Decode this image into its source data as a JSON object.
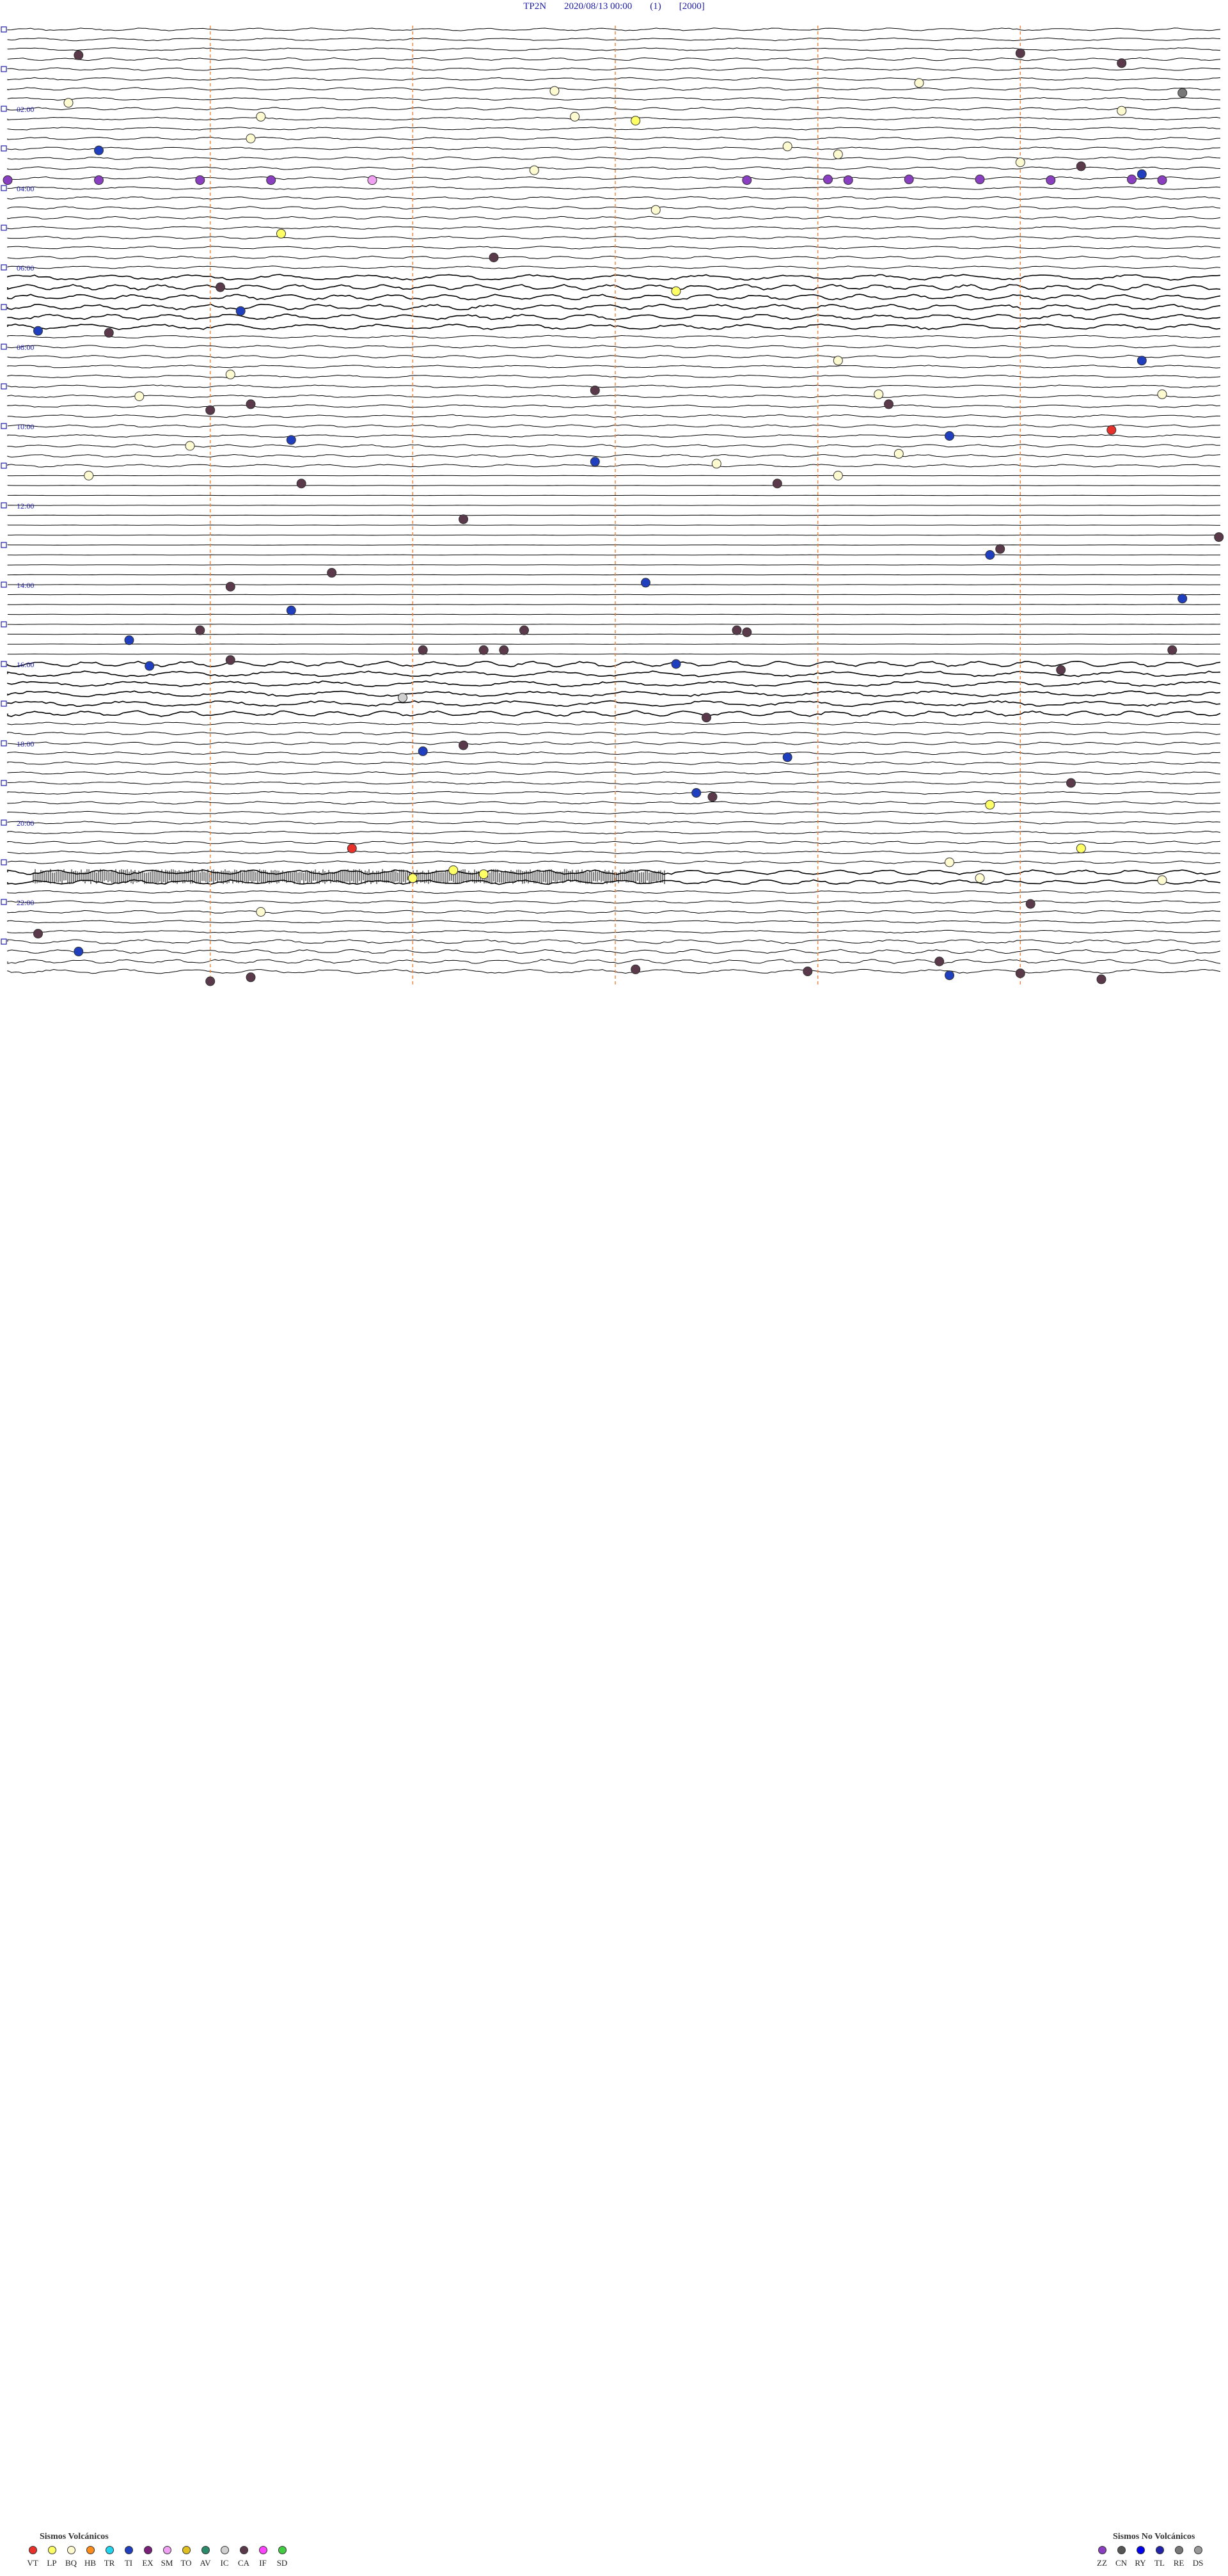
{
  "header": {
    "station": "TP2N",
    "datetime": "2020/08/13 00:00",
    "channel": "(1)",
    "scale": "[2000]"
  },
  "chart_data": {
    "type": "helicorder",
    "traces_per_hour": 4,
    "hours": 24,
    "time_labels": [
      "02:00",
      "04:00",
      "06:00",
      "08:00",
      "10:00",
      "12:00",
      "14:00",
      "16:00",
      "18:00",
      "20:00",
      "22:00"
    ],
    "minute_markers": [
      10,
      20,
      30,
      40,
      50
    ],
    "event_colors": {
      "VT": "#e8312b",
      "LP": "#ffff66",
      "BQ": "#fffbd0",
      "HB": "#ff8c1a",
      "TR": "#22d4ee",
      "TI": "#1f3fbf",
      "EX": "#7a1f7a",
      "SM": "#f0a0f0",
      "TO": "#e0c020",
      "AV": "#2a8a6a",
      "IC": "#d0d0d0",
      "CA": "#5a3a4a",
      "IF": "#ff44ff",
      "SD": "#44cc44",
      "ZZ": "#8a3fc0",
      "CN": "#555555",
      "RY": "#0000ee",
      "TL": "#2222aa",
      "RE": "#777777",
      "DS": "#999999"
    },
    "events": [
      {
        "h": 0.65,
        "m": 3.5,
        "t": "CA"
      },
      {
        "h": 0.6,
        "m": 50,
        "t": "CA"
      },
      {
        "h": 0.85,
        "m": 55,
        "t": "CA"
      },
      {
        "h": 1.35,
        "m": 45,
        "t": "BQ"
      },
      {
        "h": 1.55,
        "m": 27,
        "t": "BQ"
      },
      {
        "h": 1.85,
        "m": 3,
        "t": "BQ"
      },
      {
        "h": 1.6,
        "m": 58,
        "t": "RE"
      },
      {
        "h": 2.05,
        "m": 55,
        "t": "BQ"
      },
      {
        "h": 2.2,
        "m": 12.5,
        "t": "BQ"
      },
      {
        "h": 2.3,
        "m": 31,
        "t": "LP"
      },
      {
        "h": 2.2,
        "m": 28,
        "t": "BQ"
      },
      {
        "h": 2.75,
        "m": 12,
        "t": "BQ"
      },
      {
        "h": 2.95,
        "m": 38.5,
        "t": "BQ"
      },
      {
        "h": 3.05,
        "m": 4.5,
        "t": "TI"
      },
      {
        "h": 3.15,
        "m": 41,
        "t": "BQ"
      },
      {
        "h": 3.35,
        "m": 50,
        "t": "BQ"
      },
      {
        "h": 3.45,
        "m": 53,
        "t": "CA"
      },
      {
        "h": 3.55,
        "m": 26,
        "t": "BQ"
      },
      {
        "h": 3.65,
        "m": 56,
        "t": "TI"
      },
      {
        "h": 3.8,
        "m": 0,
        "t": "ZZ"
      },
      {
        "h": 3.8,
        "m": 4.5,
        "t": "ZZ"
      },
      {
        "h": 3.8,
        "m": 9.5,
        "t": "ZZ"
      },
      {
        "h": 3.8,
        "m": 13,
        "t": "ZZ"
      },
      {
        "h": 3.8,
        "m": 18,
        "t": "SM"
      },
      {
        "h": 3.8,
        "m": 36.5,
        "t": "ZZ"
      },
      {
        "h": 3.78,
        "m": 40.5,
        "t": "ZZ"
      },
      {
        "h": 3.78,
        "m": 44.5,
        "t": "ZZ"
      },
      {
        "h": 3.8,
        "m": 41.5,
        "t": "ZZ"
      },
      {
        "h": 3.78,
        "m": 48,
        "t": "ZZ"
      },
      {
        "h": 3.8,
        "m": 51.5,
        "t": "ZZ"
      },
      {
        "h": 3.78,
        "m": 55.5,
        "t": "ZZ"
      },
      {
        "h": 3.8,
        "m": 57,
        "t": "ZZ"
      },
      {
        "h": 4.55,
        "m": 32,
        "t": "BQ"
      },
      {
        "h": 5.15,
        "m": 13.5,
        "t": "LP"
      },
      {
        "h": 5.75,
        "m": 24,
        "t": "CA"
      },
      {
        "h": 6.5,
        "m": 10.5,
        "t": "CA"
      },
      {
        "h": 6.6,
        "m": 33,
        "t": "LP"
      },
      {
        "h": 7.1,
        "m": 11.5,
        "t": "TI"
      },
      {
        "h": 7.6,
        "m": 1.5,
        "t": "TI"
      },
      {
        "h": 7.65,
        "m": 5,
        "t": "CA"
      },
      {
        "h": 8.35,
        "m": 41,
        "t": "BQ"
      },
      {
        "h": 8.35,
        "m": 56,
        "t": "TI"
      },
      {
        "h": 8.7,
        "m": 11,
        "t": "BQ"
      },
      {
        "h": 9.1,
        "m": 29,
        "t": "CA"
      },
      {
        "h": 9.25,
        "m": 6.5,
        "t": "BQ"
      },
      {
        "h": 9.2,
        "m": 43,
        "t": "BQ"
      },
      {
        "h": 9.2,
        "m": 57,
        "t": "BQ"
      },
      {
        "h": 9.45,
        "m": 12,
        "t": "CA"
      },
      {
        "h": 9.6,
        "m": 10,
        "t": "CA"
      },
      {
        "h": 9.45,
        "m": 43.5,
        "t": "CA"
      },
      {
        "h": 10.1,
        "m": 54.5,
        "t": "VT"
      },
      {
        "h": 10.25,
        "m": 46.5,
        "t": "TI"
      },
      {
        "h": 10.35,
        "m": 14,
        "t": "TI"
      },
      {
        "h": 10.5,
        "m": 9,
        "t": "BQ"
      },
      {
        "h": 10.7,
        "m": 44,
        "t": "BQ"
      },
      {
        "h": 10.95,
        "m": 35,
        "t": "BQ"
      },
      {
        "h": 10.9,
        "m": 29,
        "t": "TI"
      },
      {
        "h": 11.25,
        "m": 4,
        "t": "BQ"
      },
      {
        "h": 11.25,
        "m": 41,
        "t": "BQ"
      },
      {
        "h": 11.45,
        "m": 14.5,
        "t": "CA"
      },
      {
        "h": 11.45,
        "m": 38,
        "t": "CA"
      },
      {
        "h": 12.35,
        "m": 22.5,
        "t": "CA"
      },
      {
        "h": 12.8,
        "m": 59.8,
        "t": "CA"
      },
      {
        "h": 13.1,
        "m": 49,
        "t": "CA"
      },
      {
        "h": 13.25,
        "m": 48.5,
        "t": "TI"
      },
      {
        "h": 13.7,
        "m": 16,
        "t": "CA"
      },
      {
        "h": 14.05,
        "m": 11,
        "t": "CA"
      },
      {
        "h": 13.95,
        "m": 31.5,
        "t": "TI"
      },
      {
        "h": 14.35,
        "m": 58,
        "t": "TI"
      },
      {
        "h": 14.65,
        "m": 14,
        "t": "TI"
      },
      {
        "h": 15.15,
        "m": 9.5,
        "t": "CA"
      },
      {
        "h": 15.15,
        "m": 25.5,
        "t": "CA"
      },
      {
        "h": 15.15,
        "m": 36,
        "t": "CA"
      },
      {
        "h": 15.2,
        "m": 36.5,
        "t": "CA"
      },
      {
        "h": 15.4,
        "m": 6,
        "t": "TI"
      },
      {
        "h": 15.65,
        "m": 20.5,
        "t": "CA"
      },
      {
        "h": 15.65,
        "m": 23.5,
        "t": "CA"
      },
      {
        "h": 15.65,
        "m": 24.5,
        "t": "CA"
      },
      {
        "h": 15.65,
        "m": 57.5,
        "t": "CA"
      },
      {
        "h": 15.9,
        "m": 11,
        "t": "CA"
      },
      {
        "h": 16.0,
        "m": 33,
        "t": "TI"
      },
      {
        "h": 16.05,
        "m": 7,
        "t": "TI"
      },
      {
        "h": 16.15,
        "m": 52,
        "t": "CA"
      },
      {
        "h": 16.85,
        "m": 19.5,
        "t": "IC"
      },
      {
        "h": 17.35,
        "m": 34.5,
        "t": "CA"
      },
      {
        "h": 18.05,
        "m": 22.5,
        "t": "CA"
      },
      {
        "h": 18.2,
        "m": 20.5,
        "t": "TI"
      },
      {
        "h": 18.35,
        "m": 38.5,
        "t": "TI"
      },
      {
        "h": 19.0,
        "m": 52.5,
        "t": "CA"
      },
      {
        "h": 19.25,
        "m": 34,
        "t": "TI"
      },
      {
        "h": 19.35,
        "m": 34.8,
        "t": "CA"
      },
      {
        "h": 19.55,
        "m": 48.5,
        "t": "LP"
      },
      {
        "h": 20.65,
        "m": 17,
        "t": "VT"
      },
      {
        "h": 20.65,
        "m": 53,
        "t": "LP"
      },
      {
        "h": 21.0,
        "m": 46.5,
        "t": "BQ"
      },
      {
        "h": 21.2,
        "m": 22,
        "t": "LP"
      },
      {
        "h": 21.3,
        "m": 23.5,
        "t": "LP"
      },
      {
        "h": 21.4,
        "m": 20,
        "t": "LP"
      },
      {
        "h": 21.4,
        "m": 48,
        "t": "BQ"
      },
      {
        "h": 21.45,
        "m": 57,
        "t": "BQ"
      },
      {
        "h": 22.05,
        "m": 50.5,
        "t": "CA"
      },
      {
        "h": 22.25,
        "m": 12.5,
        "t": "BQ"
      },
      {
        "h": 22.8,
        "m": 1.5,
        "t": "CA"
      },
      {
        "h": 23.25,
        "m": 3.5,
        "t": "TI"
      },
      {
        "h": 23.5,
        "m": 46,
        "t": "CA"
      },
      {
        "h": 23.7,
        "m": 31,
        "t": "CA"
      },
      {
        "h": 23.75,
        "m": 39.5,
        "t": "CA"
      },
      {
        "h": 23.8,
        "m": 50,
        "t": "CA"
      },
      {
        "h": 23.9,
        "m": 12,
        "t": "CA"
      },
      {
        "h": 23.85,
        "m": 46.5,
        "t": "TI"
      },
      {
        "h": 23.95,
        "m": 54,
        "t": "CA"
      },
      {
        "h": 24.0,
        "m": 10,
        "t": "CA"
      }
    ]
  },
  "legend": {
    "volcanic_title": "Sismos Volcánicos",
    "volcanic": [
      "VT",
      "LP",
      "BQ",
      "HB",
      "TR",
      "TI",
      "EX",
      "SM",
      "TO",
      "AV",
      "IC",
      "CA",
      "IF",
      "SD"
    ],
    "non_volcanic_title": "Sismos No Volcánicos",
    "non_volcanic": [
      "ZZ",
      "CN",
      "RY",
      "TL",
      "RE",
      "DS"
    ]
  }
}
